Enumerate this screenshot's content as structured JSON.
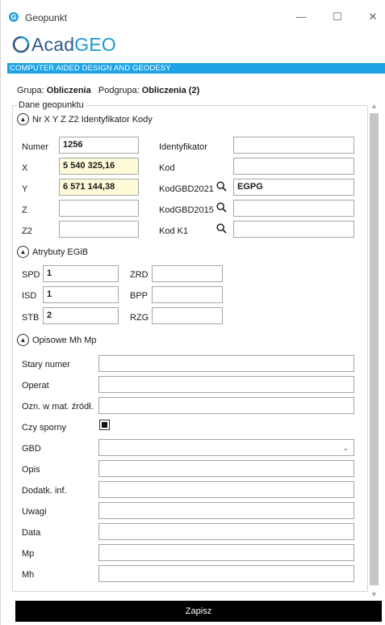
{
  "window": {
    "title": "Geopunkt",
    "minimize": "—",
    "maximize": "☐",
    "close": "✕",
    "icon_letter": "G"
  },
  "logo": {
    "acad": "Acad",
    "geo": "GEO"
  },
  "banner": "COMPUTER AIDED DESIGN AND GEODESY",
  "group": {
    "grupa_label": "Grupa:",
    "grupa_value": "Obliczenia",
    "podgrupa_label": "Podgrupa:",
    "podgrupa_value": "Obliczenia (2)"
  },
  "fieldset_legend": "Dane geopunktu",
  "section1": {
    "title": "Nr X Y Z Z2 Identyfikator Kody",
    "numer_label": "Numer",
    "numer_value": "1256",
    "x_label": "X",
    "x_value": "5 540 325,16",
    "y_label": "Y",
    "y_value": "6 571 144,38",
    "z_label": "Z",
    "z_value": "",
    "z2_label": "Z2",
    "z2_value": "",
    "identyfikator_label": "Identyfikator",
    "identyfikator_value": "",
    "kod_label": "Kod",
    "kod_value": "",
    "kodgbd2021_label": "KodGBD2021",
    "kodgbd2021_value": "EGPG",
    "kodgbd2015_label": "KodGBD2015",
    "kodgbd2015_value": "",
    "kodk1_label": "Kod K1",
    "kodk1_value": ""
  },
  "section2": {
    "title": "Atrybuty EGiB",
    "spd_label": "SPD",
    "spd_value": "1",
    "isd_label": "ISD",
    "isd_value": "1",
    "stb_label": "STB",
    "stb_value": "2",
    "zrd_label": "ZRD",
    "zrd_value": "",
    "bpp_label": "BPP",
    "bpp_value": "",
    "rzg_label": "RZG",
    "rzg_value": ""
  },
  "section3": {
    "title": "Opisowe Mh Mp",
    "stary_numer_label": "Stary numer",
    "operat_label": "Operat",
    "ozn_label": "Ozn. w mat. źródł.",
    "czy_sporny_label": "Czy sporny",
    "czy_sporny_checked": true,
    "gbd_label": "GBD",
    "gbd_value": "",
    "opis_label": "Opis",
    "dodatk_label": "Dodatk. inf.",
    "uwagi_label": "Uwagi",
    "data_label": "Data",
    "mp_label": "Mp",
    "mh_label": "Mh"
  },
  "save_label": "Zapisz",
  "colors": {
    "banner": "#1ea4e6",
    "highlight_input": "#fffbd8",
    "save_button": "#000000",
    "logo_acad": "#2e5a8a",
    "logo_geo": "#1a97d4"
  }
}
